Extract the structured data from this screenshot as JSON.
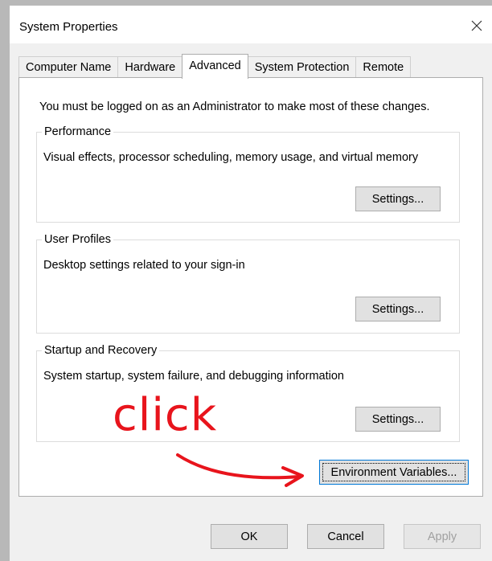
{
  "window": {
    "title": "System Properties"
  },
  "tabs": [
    {
      "label": "Computer Name",
      "active": false
    },
    {
      "label": "Hardware",
      "active": false
    },
    {
      "label": "Advanced",
      "active": true
    },
    {
      "label": "System Protection",
      "active": false
    },
    {
      "label": "Remote",
      "active": false
    }
  ],
  "advanced": {
    "admin_note": "You must be logged on as an Administrator to make most of these changes.",
    "performance": {
      "label": "Performance",
      "description": "Visual effects, processor scheduling, memory usage, and virtual memory",
      "button": "Settings..."
    },
    "user_profiles": {
      "label": "User Profiles",
      "description": "Desktop settings related to your sign-in",
      "button": "Settings..."
    },
    "startup_recovery": {
      "label": "Startup and Recovery",
      "description": "System startup, system failure, and debugging information",
      "button": "Settings..."
    },
    "env_button": "Environment Variables..."
  },
  "annotation": {
    "text": "click",
    "color": "#e8141c"
  },
  "footer": {
    "ok": "OK",
    "cancel": "Cancel",
    "apply": "Apply"
  },
  "icons": {
    "close": "close-icon"
  },
  "colors": {
    "focus_border": "#0078d7",
    "window_bg": "#f0f0f0",
    "annotation": "#e8141c"
  }
}
